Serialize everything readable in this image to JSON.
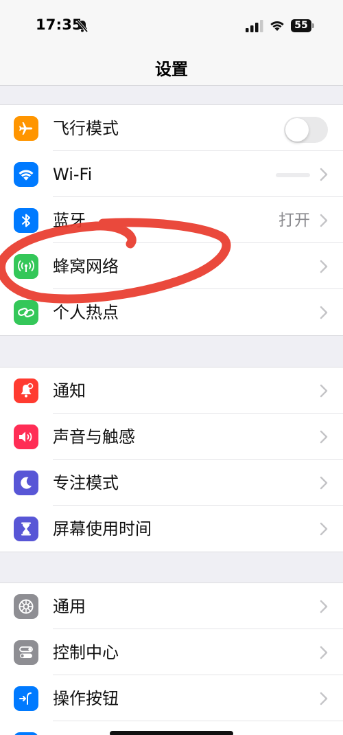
{
  "status_bar": {
    "time": "17:35",
    "battery_level": "55"
  },
  "nav": {
    "title": "设置"
  },
  "groups": [
    {
      "items": [
        {
          "label": "飞行模式",
          "icon": "airplane-icon",
          "color": "#FF9500",
          "control": "toggle",
          "toggle_on": false
        },
        {
          "label": "Wi-Fi",
          "icon": "wifi-icon",
          "color": "#007AFF",
          "control": "chevron"
        },
        {
          "label": "蓝牙",
          "icon": "bluetooth-icon",
          "color": "#007AFF",
          "value": "打开",
          "control": "chevron"
        },
        {
          "label": "蜂窝网络",
          "icon": "cellular-icon",
          "color": "#34C759",
          "control": "chevron"
        },
        {
          "label": "个人热点",
          "icon": "hotspot-icon",
          "color": "#34C759",
          "control": "chevron"
        }
      ]
    },
    {
      "items": [
        {
          "label": "通知",
          "icon": "bell-icon",
          "color": "#FF3B30",
          "control": "chevron"
        },
        {
          "label": "声音与触感",
          "icon": "speaker-icon",
          "color": "#FF2D55",
          "control": "chevron"
        },
        {
          "label": "专注模式",
          "icon": "moon-icon",
          "color": "#5856D6",
          "control": "chevron"
        },
        {
          "label": "屏幕使用时间",
          "icon": "hourglass-icon",
          "color": "#5856D6",
          "control": "chevron"
        }
      ]
    },
    {
      "items": [
        {
          "label": "通用",
          "icon": "gear-icon",
          "color": "#8E8E93",
          "control": "chevron"
        },
        {
          "label": "控制中心",
          "icon": "switches-icon",
          "color": "#8E8E93",
          "control": "chevron"
        },
        {
          "label": "操作按钮",
          "icon": "action-button-icon",
          "color": "#007AFF",
          "control": "chevron"
        }
      ]
    }
  ],
  "colors": {
    "annotation": "#E8392B",
    "background": "#EFEFF4"
  }
}
